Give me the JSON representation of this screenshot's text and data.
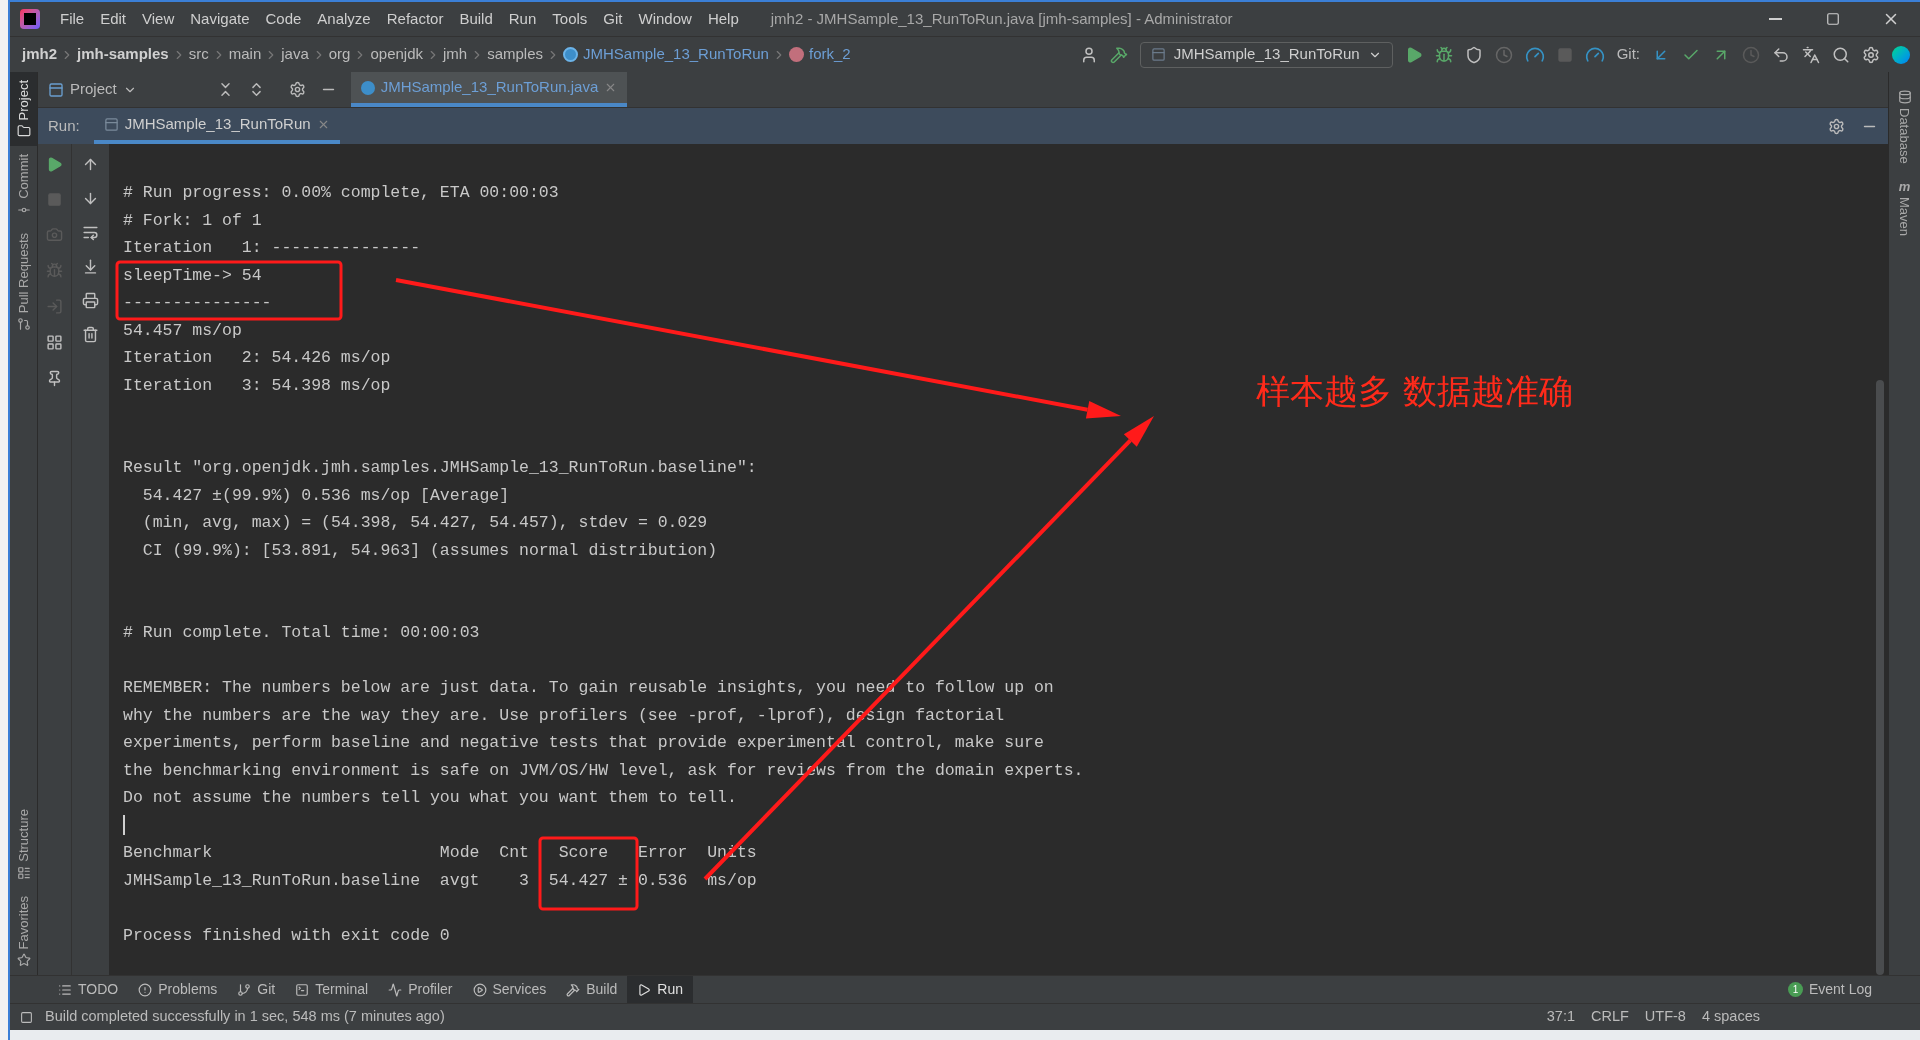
{
  "window": {
    "title": "jmh2 - JMHSample_13_RunToRun.java [jmh-samples] - Administrator"
  },
  "menu": [
    "File",
    "Edit",
    "View",
    "Navigate",
    "Code",
    "Analyze",
    "Refactor",
    "Build",
    "Run",
    "Tools",
    "Git",
    "Window",
    "Help"
  ],
  "breadcrumb": [
    {
      "label": "jmh2",
      "kind": "root"
    },
    {
      "label": "jmh-samples",
      "kind": "root"
    },
    {
      "label": "src",
      "kind": "folder"
    },
    {
      "label": "main",
      "kind": "folder"
    },
    {
      "label": "java",
      "kind": "folder"
    },
    {
      "label": "org",
      "kind": "folder"
    },
    {
      "label": "openjdk",
      "kind": "folder"
    },
    {
      "label": "jmh",
      "kind": "folder"
    },
    {
      "label": "samples",
      "kind": "folder"
    },
    {
      "label": "JMHSample_13_RunToRun",
      "kind": "class"
    },
    {
      "label": "fork_2",
      "kind": "method"
    }
  ],
  "run_config": {
    "label": "JMHSample_13_RunToRun"
  },
  "git_label": "Git:",
  "project_panel": {
    "title": "Project"
  },
  "editor_tabs": [
    {
      "label": "JMHSample_13_RunToRun.java",
      "selected": true
    }
  ],
  "run_panel": {
    "label": "Run:",
    "tabs": [
      {
        "label": "JMHSample_13_RunToRun",
        "selected": true
      }
    ]
  },
  "console": {
    "lines": [
      {
        "kind": "text",
        "text": "# Run progress: 0.00% complete, ETA 00:00:03"
      },
      {
        "kind": "text",
        "text": "# Fork: 1 of 1"
      },
      {
        "kind": "text",
        "text": "Iteration   1: ---------------"
      },
      {
        "kind": "text",
        "text": "sleepTime-> 54"
      },
      {
        "kind": "text",
        "text": "---------------"
      },
      {
        "kind": "text",
        "text": "54.457 ms/op"
      },
      {
        "kind": "text",
        "text": "Iteration   2: 54.426 ms/op"
      },
      {
        "kind": "text",
        "text": "Iteration   3: 54.398 ms/op"
      },
      {
        "kind": "blank"
      },
      {
        "kind": "blank"
      },
      {
        "kind": "text",
        "text": "Result \"org.openjdk.jmh.samples.JMHSample_13_RunToRun.baseline\":"
      },
      {
        "kind": "text",
        "text": "  54.427 ±(99.9%) 0.536 ms/op [Average]"
      },
      {
        "kind": "text",
        "text": "  (min, avg, max) = (54.398, 54.427, 54.457), stdev = 0.029"
      },
      {
        "kind": "text",
        "text": "  CI (99.9%): [53.891, 54.963] (assumes normal distribution)"
      },
      {
        "kind": "blank"
      },
      {
        "kind": "blank"
      },
      {
        "kind": "text",
        "text": "# Run complete. Total time: 00:00:03"
      },
      {
        "kind": "blank"
      },
      {
        "kind": "text",
        "text": "REMEMBER: The numbers below are just data. To gain reusable insights, you need to follow up on"
      },
      {
        "kind": "text",
        "text": "why the numbers are the way they are. Use profilers (see -prof, -lprof), design factorial"
      },
      {
        "kind": "text",
        "text": "experiments, perform baseline and negative tests that provide experimental control, make sure"
      },
      {
        "kind": "text",
        "text": "the benchmarking environment is safe on JVM/OS/HW level, ask for reviews from the domain experts."
      },
      {
        "kind": "text",
        "text": "Do not assume the numbers tell you what you want them to tell."
      },
      {
        "kind": "cursor"
      },
      {
        "kind": "text",
        "text": "Benchmark                       Mode  Cnt   Score   Error  Units"
      },
      {
        "kind": "text",
        "text": "JMHSample_13_RunToRun.baseline  avgt    3  54.427 ± 0.536  ms/op"
      },
      {
        "kind": "blank"
      },
      {
        "kind": "text",
        "text": "Process finished with exit code 0"
      }
    ]
  },
  "annotation": {
    "note": "样本越多 数据越准确"
  },
  "left_stripe": [
    {
      "label": "Project",
      "kind": "project",
      "selected": true
    },
    {
      "label": "Commit",
      "kind": "commit",
      "selected": false
    },
    {
      "label": "Pull Requests",
      "kind": "pull",
      "selected": false
    },
    {
      "kind": "spacer"
    },
    {
      "label": "Structure",
      "kind": "structure",
      "selected": false
    },
    {
      "label": "Favorites",
      "kind": "favorites",
      "selected": false
    }
  ],
  "right_stripe": [
    {
      "label": "Database",
      "kind": "database"
    },
    {
      "label": "Maven",
      "kind": "maven",
      "glyph": "m"
    }
  ],
  "bottom_tabs": [
    {
      "label": "TODO",
      "kind": "todo",
      "selected": false
    },
    {
      "label": "Problems",
      "kind": "problems",
      "selected": false
    },
    {
      "label": "Git",
      "kind": "git",
      "selected": false
    },
    {
      "label": "Terminal",
      "kind": "terminal",
      "selected": false
    },
    {
      "label": "Profiler",
      "kind": "profiler",
      "selected": false
    },
    {
      "label": "Services",
      "kind": "services",
      "selected": false
    },
    {
      "label": "Build",
      "kind": "build",
      "selected": false
    },
    {
      "label": "Run",
      "kind": "run",
      "selected": true
    }
  ],
  "event_log": {
    "label": "Event Log",
    "count": "1"
  },
  "status_bar": {
    "message": "Build completed successfully in 1 sec, 548 ms (7 minutes ago)",
    "items": [
      "37:1",
      "CRLF",
      "UTF-8",
      "4 spaces"
    ]
  }
}
